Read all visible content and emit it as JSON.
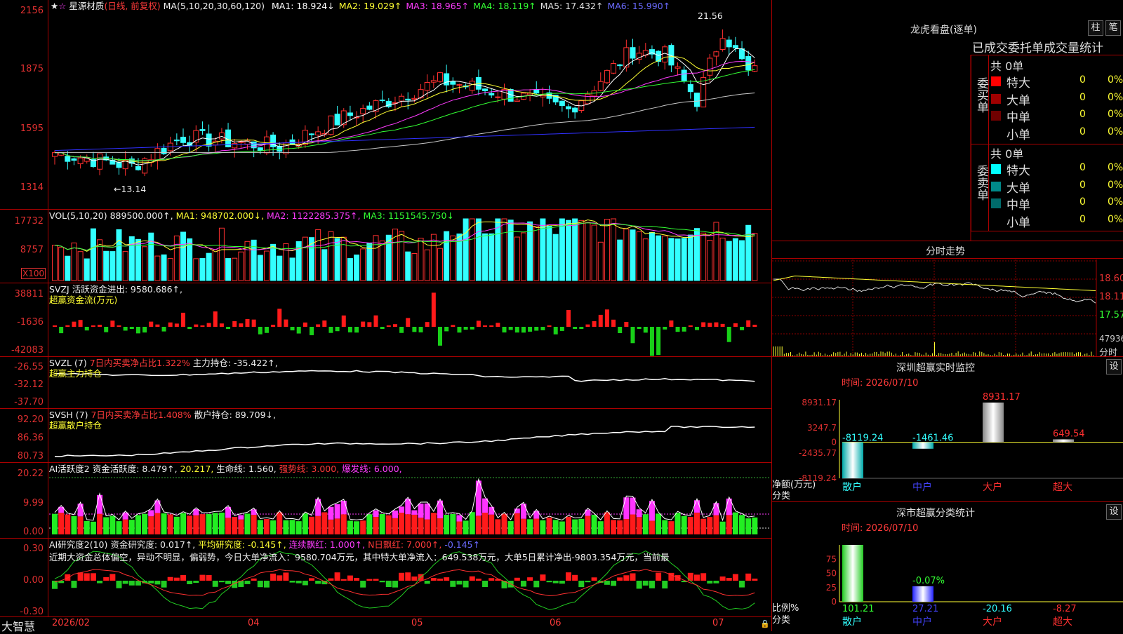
{
  "app": {
    "name": "大智慧"
  },
  "stock": {
    "name": "星源材质",
    "mode": "(日线, 前复权)",
    "ma_label": "MA(5,10,20,30,60,120)",
    "ma_values": [
      {
        "k": "MA1:",
        "v": "18.924↓",
        "c": "#fff"
      },
      {
        "k": "MA2:",
        "v": "19.029↑",
        "c": "#ffff33"
      },
      {
        "k": "MA3:",
        "v": "18.965↑",
        "c": "#ff3cff"
      },
      {
        "k": "MA4:",
        "v": "18.119↑",
        "c": "#33ff33"
      },
      {
        "k": "MA5:",
        "v": "17.432↑",
        "c": "#e0e0e0"
      },
      {
        "k": "MA6:",
        "v": "15.990↑",
        "c": "#6a6aff"
      }
    ],
    "yaxis": [
      "2156",
      "1875",
      "1595",
      "1314"
    ],
    "high_label": "21.56",
    "low_label": "←13.14"
  },
  "vol": {
    "header": "VOL(5,10,20)",
    "v0": "889500.000↑,",
    "ma1": "MA1: 948702.000↓,",
    "ma2": "MA2: 1122285.375↑,",
    "ma3": "MA3: 1151545.750↓",
    "yaxis": [
      "17732",
      "8757"
    ],
    "unit": "X100"
  },
  "svzj": {
    "header": "SVZJ",
    "line1": "活跃资金进出: 9580.686↑,",
    "line2": "超赢资金流(万元)",
    "yaxis": [
      "38811",
      "-1636",
      "-42083"
    ]
  },
  "svzl": {
    "header": "SVZL (7)",
    "a": "7日内买卖净占比1.322%",
    "b": "主力持仓: -35.422↑,",
    "line2": "超赢主力持仓",
    "yaxis": [
      "-26.55",
      "-32.12",
      "-37.70"
    ]
  },
  "svsh": {
    "header": "SVSH (7)",
    "a": "7日内买卖净占比1.408%",
    "b": "散户持仓: 89.709↓,",
    "line2": "超赢散户持仓",
    "yaxis": [
      "92.20",
      "86.36",
      "80.73"
    ]
  },
  "ai1": {
    "header": "AI活跃度2",
    "a": "资金活跃度: 8.479↑,",
    "b": "20.217,",
    "c": "生命线: 1.560,",
    "d": "强势线: 3.000,",
    "e": "爆发线: 6.000,",
    "yaxis": [
      "20.22",
      "9.99",
      "0.00"
    ]
  },
  "ai2": {
    "header": "AI研究度2(10)",
    "a": "资金研究度: 0.017↑,",
    "b": "平均研究度: -0.145↑,",
    "c": "连续飘红: 1.000↑,",
    "d": "N日飘红: 7.000↑,",
    "e": "-0.145↑",
    "comment": "近期大资金总体偏空，异动不明显，偏弱势，今日大单净流入：9580.704万元，其中特大单净流入：649.538万元，大单5日累计净出-9803.354万元，当前最",
    "yaxis": [
      "0.30",
      "0.00",
      "-0.30"
    ]
  },
  "xaxis": [
    "2026/02",
    "04",
    "05",
    "06",
    "07"
  ],
  "lhb": {
    "title": "龙虎看盘(逐单)",
    "btn1": "柱",
    "btn2": "笔",
    "subtitle": "已成交委托单成交量统计",
    "buy": {
      "side": "委买单",
      "total": "共 0单",
      "rows": [
        {
          "name": "特大",
          "n": "0",
          "p": "0%",
          "c": "#ff0000"
        },
        {
          "name": "大单",
          "n": "0",
          "p": "0%",
          "c": "#a00000"
        },
        {
          "name": "中单",
          "n": "0",
          "p": "0%",
          "c": "#700000"
        },
        {
          "name": "小单",
          "n": "0",
          "p": "0%",
          "c": "#000"
        }
      ]
    },
    "sell": {
      "side": "委卖单",
      "total": "共 0单",
      "rows": [
        {
          "name": "特大",
          "n": "0",
          "p": "0%",
          "c": "#00ffff"
        },
        {
          "name": "大单",
          "n": "0",
          "p": "0%",
          "c": "#008888"
        },
        {
          "name": "中单",
          "n": "0",
          "p": "0%",
          "c": "#006a6a"
        },
        {
          "name": "小单",
          "n": "0",
          "p": "0%",
          "c": "#000"
        }
      ]
    }
  },
  "fenshi": {
    "title": "分时走势",
    "prices": [
      "18.60",
      "18.11",
      "17.57"
    ],
    "vol": "47936",
    "vol_label": "分时"
  },
  "monitor": {
    "title": "深圳超赢实时监控",
    "btn": "设",
    "time": "时间: 2026/07/10",
    "yaxis": [
      "8931.17",
      "3247.7",
      "0",
      "-2435.77",
      "-8119.24"
    ],
    "bars": [
      {
        "cat": "散户",
        "val": -8119.24,
        "label": "-8119.24"
      },
      {
        "cat": "中户",
        "val": -1461.46,
        "label": "-1461.46"
      },
      {
        "cat": "大户",
        "val": 8931.17,
        "label": "8931.17"
      },
      {
        "cat": "超大",
        "val": 649.54,
        "label": "649.54"
      }
    ],
    "unit1": "净额(万元)",
    "unit2": "分类"
  },
  "stats": {
    "title": "深市超赢分类统计",
    "btn": "设",
    "time": "时间: 2026/07/10",
    "yaxis": [
      "75",
      "50",
      "25",
      "0"
    ],
    "bars": [
      {
        "cat": "散户",
        "val": 101.21,
        "label": "101.21"
      },
      {
        "cat": "中户",
        "val": 27.21,
        "label": "27.21"
      },
      {
        "cat": "大户",
        "val": -20.16,
        "label": "-20.16"
      },
      {
        "cat": "超大",
        "val": -8.27,
        "label": "-8.27"
      }
    ],
    "extra_label": "-0.07%",
    "unit1": "比例%",
    "unit2": "分类"
  }
}
